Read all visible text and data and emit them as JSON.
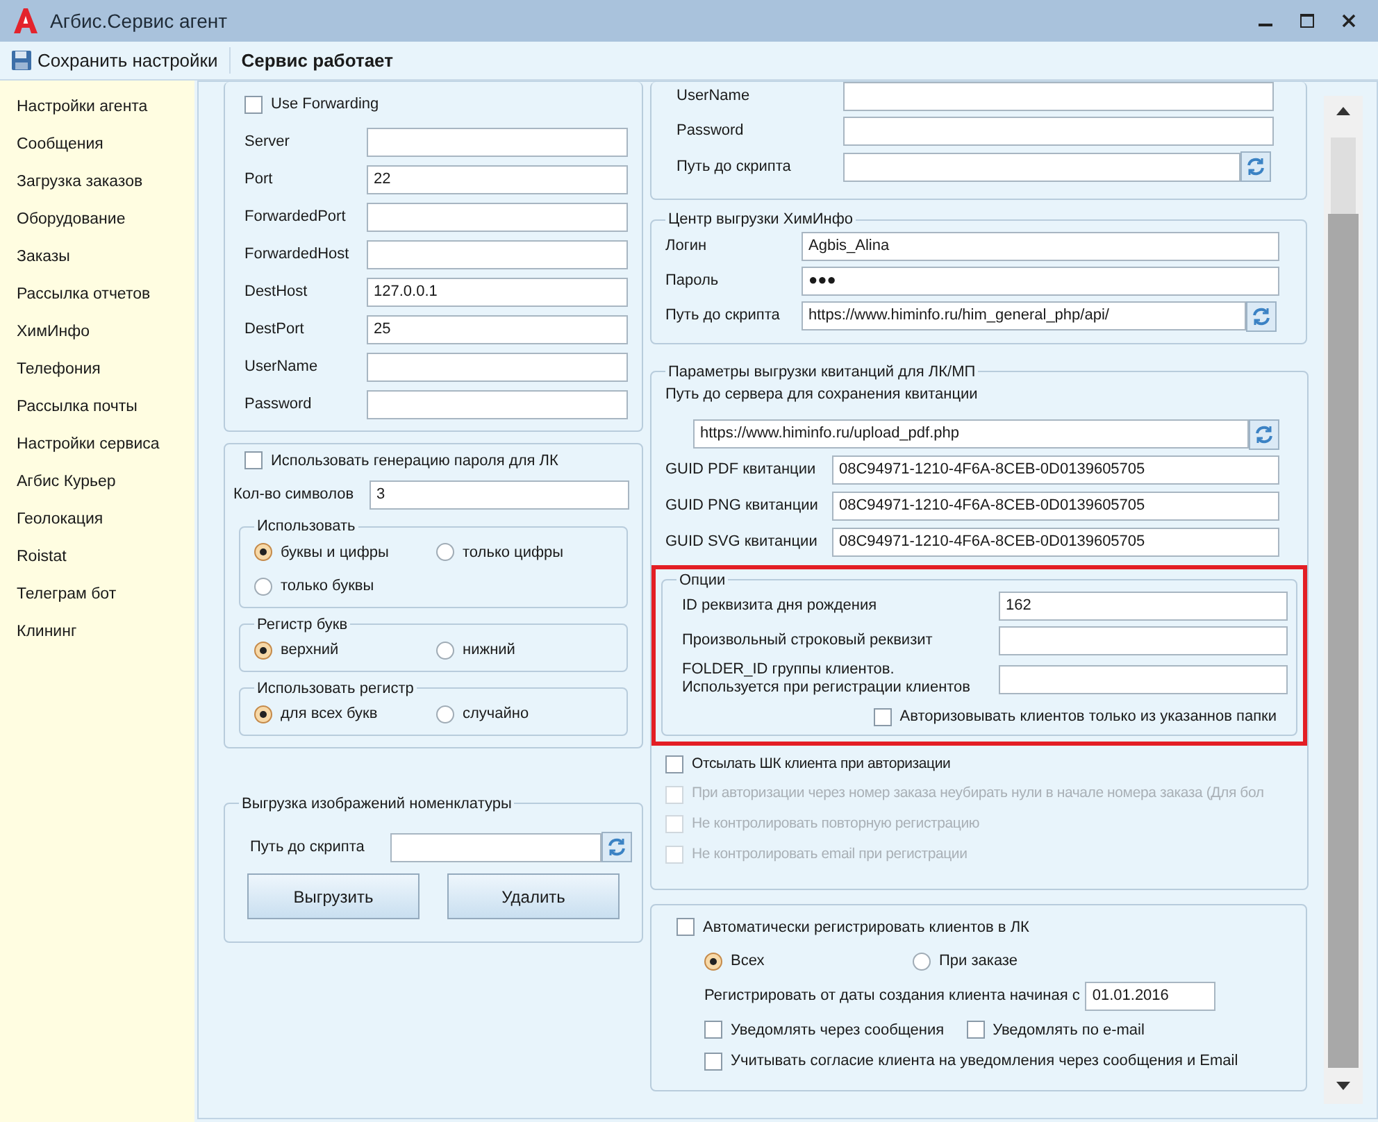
{
  "window": {
    "title": "Агбис.Сервис агент"
  },
  "toolbar": {
    "save_button": "Сохранить настройки",
    "status": "Сервис работает"
  },
  "sidebar": {
    "items": [
      {
        "label": "Настройки агента"
      },
      {
        "label": "Сообщения"
      },
      {
        "label": "Загрузка заказов"
      },
      {
        "label": "Оборудование"
      },
      {
        "label": "Заказы"
      },
      {
        "label": "Рассылка отчетов"
      },
      {
        "label": "ХимИнфо"
      },
      {
        "label": "Телефония"
      },
      {
        "label": "Рассылка почты"
      },
      {
        "label": "Настройки сервиса"
      },
      {
        "label": "Агбис Курьер"
      },
      {
        "label": "Геолокация"
      },
      {
        "label": "Roistat"
      },
      {
        "label": "Телеграм бот"
      },
      {
        "label": "Клининг"
      }
    ]
  },
  "forwarding": {
    "checkbox": {
      "label": "Use Forwarding",
      "checked": false
    },
    "fields": [
      {
        "label": "Server"
      },
      {
        "label": "Port",
        "value": "22"
      },
      {
        "label": "ForwardedPort"
      },
      {
        "label": "ForwardedHost"
      },
      {
        "label": "DestHost",
        "value": "127.0.0.1"
      },
      {
        "label": "DestPort",
        "value": "25"
      },
      {
        "label": "UserName"
      },
      {
        "label": "Password"
      }
    ]
  },
  "password_generation": {
    "checkbox": {
      "label": "Использовать генерацию пароля для ЛК",
      "checked": false
    },
    "length": {
      "label": "Кол-во символов",
      "value": "3"
    },
    "groups": [
      {
        "title": "Использовать",
        "options": [
          {
            "label": "буквы и цифры",
            "selected": true
          },
          {
            "label": "только цифры",
            "selected": false
          },
          {
            "label": "только буквы",
            "selected": false
          }
        ]
      },
      {
        "title": "Регистр букв",
        "options": [
          {
            "label": "верхний",
            "selected": true
          },
          {
            "label": "нижний",
            "selected": false
          }
        ]
      },
      {
        "title": "Использовать регистр",
        "options": [
          {
            "label": "для всех букв",
            "selected": true
          },
          {
            "label": "случайно",
            "selected": false
          }
        ]
      }
    ]
  },
  "image_export": {
    "title": "Выгрузка изображений номенклатуры",
    "script_label": "Путь до скрипта",
    "buttons": [
      "Выгрузить",
      "Удалить"
    ]
  },
  "script_upload": {
    "fields": [
      {
        "label": "UserName",
        "refresh": false
      },
      {
        "label": "Password",
        "refresh": false
      },
      {
        "label": "Путь до скрипта",
        "refresh": true
      }
    ]
  },
  "himinfo": {
    "title": "Центр выгрузки ХимИнфо",
    "fields": [
      {
        "label": "Логин",
        "value": "Agbis_Alina",
        "refresh": false
      },
      {
        "label": "Пароль",
        "value": "●●●",
        "refresh": false
      },
      {
        "label": "Путь до скрипта",
        "value": "https://www.himinfo.ru/him_general_php/api/",
        "refresh": true
      }
    ]
  },
  "receipts": {
    "title": "Параметры выгрузки квитанций для ЛК/МП",
    "server_label": "Путь до сервера для сохранения квитанции",
    "server_value": "https://www.himinfo.ru/upload_pdf.php",
    "fields": [
      {
        "label": "GUID PDF квитанции",
        "value": "08C94971-1210-4F6A-8CEB-0D0139605705"
      },
      {
        "label": "GUID PNG квитанции",
        "value": "08C94971-1210-4F6A-8CEB-0D0139605705"
      },
      {
        "label": "GUID SVG квитанции",
        "value": "08C94971-1210-4F6A-8CEB-0D0139605705"
      }
    ],
    "options": {
      "title": "Опции",
      "fields": [
        {
          "label": "ID реквизита дня рождения",
          "value": "162"
        },
        {
          "label": "Произвольный строковый реквизит"
        },
        {
          "label": "FOLDER_ID группы клиентов.\nИспользуется при регистрации клиентов"
        }
      ],
      "folder_checkbox": {
        "label": "Авторизовывать клиентов только из указаннов папки",
        "checked": false
      }
    },
    "checkboxes": [
      {
        "label": "Отсылать ШК клиента при авторизации",
        "checked": false,
        "disabled": false
      },
      {
        "label": "При авторизации через номер заказа неубирать нули в начале номера заказа (Для бол",
        "checked": false,
        "disabled": true
      },
      {
        "label": "Не контролировать повторную регистрацию",
        "checked": false,
        "disabled": true
      },
      {
        "label": "Не контролировать email при регистрации",
        "checked": false,
        "disabled": true
      }
    ]
  },
  "auto_register": {
    "checkbox": {
      "label": "Автоматически регистрировать клиентов в ЛК",
      "checked": false
    },
    "options": [
      {
        "label": "Всех",
        "selected": true
      },
      {
        "label": "При заказе",
        "selected": false
      }
    ],
    "date": {
      "label": "Регистрировать от даты создания клиента начиная с",
      "value": "01.01.2016"
    },
    "checkboxes": [
      {
        "label": "Уведомлять через сообщения",
        "checked": false
      },
      {
        "label": "Уведомлять по e-mail",
        "checked": false
      },
      {
        "label": "Учитывать согласие клиента на уведомления через сообщения и Email",
        "checked": false
      }
    ]
  }
}
